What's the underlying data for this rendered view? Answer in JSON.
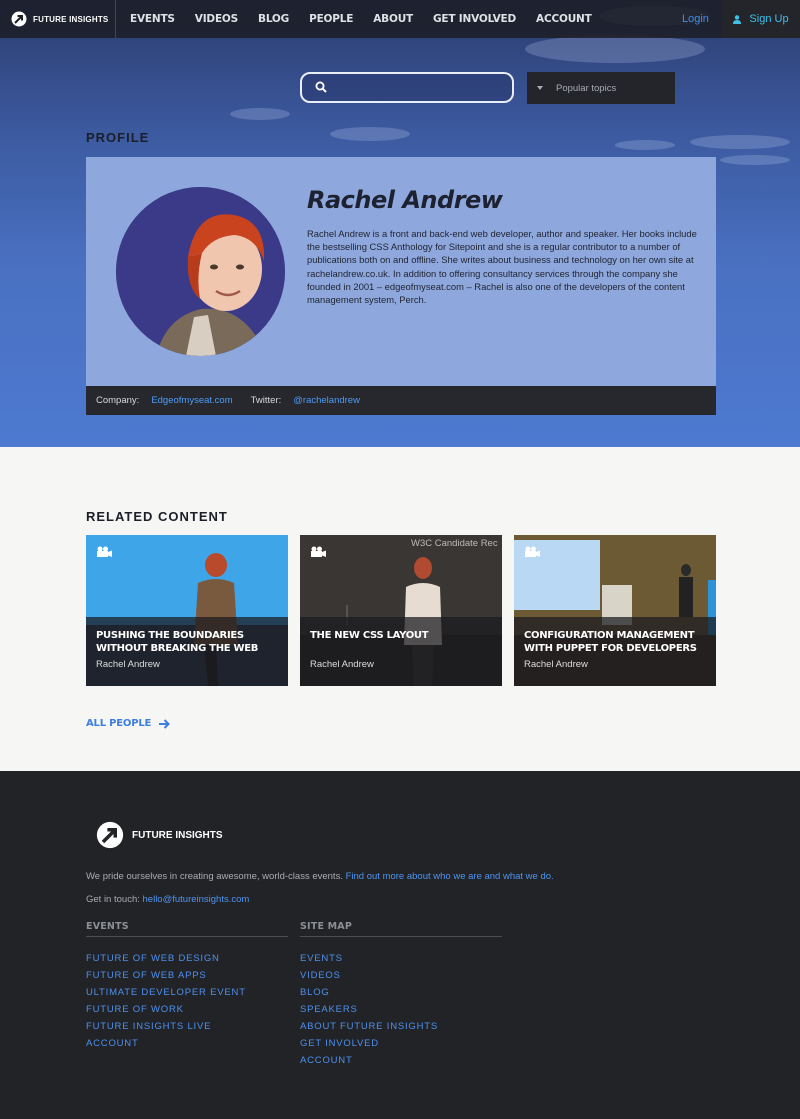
{
  "nav": {
    "brand": "FUTURE INSIGHTS",
    "links": [
      "EVENTS",
      "VIDEOS",
      "BLOG",
      "PEOPLE",
      "ABOUT",
      "GET INVOLVED",
      "ACCOUNT"
    ],
    "login": "Login",
    "signup": "Sign Up"
  },
  "search": {
    "placeholder": "",
    "topics_label": "Popular topics"
  },
  "profile": {
    "section_title": "PROFILE",
    "name": "Rachel Andrew",
    "bio": "Rachel Andrew is a front and back-end web developer, author and speaker. Her books include the bestselling CSS Anthology for Sitepoint and she is a regular contributor to a number of publications both on and offline. She writes about business and technology on her own site at rachelandrew.co.uk. In addition to offering consultancy services through the company she founded in 2001 – edgeofmyseat.com – Rachel is also one of the developers of the content management system, Perch.",
    "company_label": "Company:",
    "company": "Edgeofmyseat.com",
    "twitter_label": "Twitter:",
    "twitter": "@rachelandrew"
  },
  "related": {
    "title": "RELATED CONTENT",
    "items": [
      {
        "title": "PUSHING THE BOUNDARIES WITHOUT BREAKING THE WEB",
        "author": "Rachel Andrew"
      },
      {
        "title": "THE NEW CSS LAYOUT",
        "author": "Rachel Andrew",
        "screen_text": "W3C Candidate Rec"
      },
      {
        "title": "CONFIGURATION MANAGEMENT WITH PUPPET FOR DEVELOPERS",
        "author": "Rachel Andrew"
      }
    ],
    "all_people": "ALL PEOPLE"
  },
  "footer": {
    "brand": "FUTURE INSIGHTS",
    "pride_text": "We pride ourselves in creating awesome, world-class events.",
    "pride_link": "Find out more about who we are and what we do.",
    "contact_label": "Get in touch:",
    "contact_email": "hello@futureinsights.com",
    "events_title": "EVENTS",
    "events": [
      "FUTURE OF WEB DESIGN",
      "FUTURE OF WEB APPS",
      "ULTIMATE DEVELOPER EVENT",
      "FUTURE OF WORK",
      "FUTURE INSIGHTS LIVE",
      "ACCOUNT"
    ],
    "sitemap_title": "SITE MAP",
    "sitemap": [
      "EVENTS",
      "VIDEOS",
      "BLOG",
      "SPEAKERS",
      "ABOUT FUTURE INSIGHTS",
      "GET INVOLVED",
      "ACCOUNT"
    ]
  },
  "colors": {
    "accent": "#3d8df2",
    "signup": "#3fc0e8",
    "footer_bg": "#222326",
    "card_bg": "#8ea7dc"
  }
}
